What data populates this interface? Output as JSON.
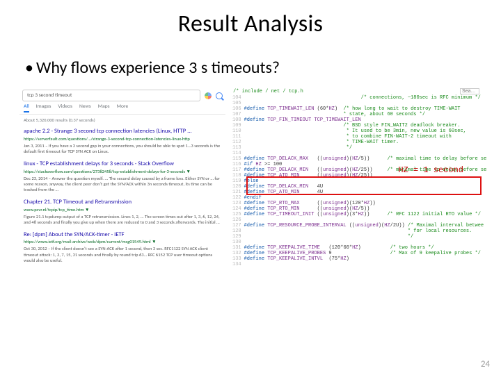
{
  "title": "Result Analysis",
  "bullet": "Why flows experience 3 s timeouts?",
  "page_number": "24",
  "hz_label": "HZ = 1 second",
  "google": {
    "query": "tcp 3 second timeout",
    "tabs": [
      "All",
      "Images",
      "Videos",
      "News",
      "Maps",
      "More"
    ],
    "stats": "About 5,320,000 results (0.37 seconds)",
    "mic_icon": "mic-icon",
    "search_icon": "search-icon",
    "results": [
      {
        "title": "apache 2.2 - Strange 3 second tcp connection latencies (Linux, HTTP ...",
        "url": "https://serverfault.com/questions/…/strange-3-second-tcp-connection-latencies-linux-http",
        "desc": "Jan 3, 2011 – If you have a 3 second gap in your connections, you should be able to spot 1…3 seconds is the default first timeout for TCP SYN ACK on Linux."
      },
      {
        "title": "linux - TCP establishment delays for 3 seconds - Stack Overflow",
        "url": "https://stackoverflow.com/questions/27382458/tcp-establishment-delays-for-3-seconds ▼",
        "desc": "Dec 23, 2014 – Answer the question myself. ... The second delay caused by a frame loss. Either SYN or … for some reason, anyway, the client peer don't get the SYN/ACK within 3n seconds timeout, its time can be tracked from the …"
      },
      {
        "title": "Chapter 21. TCP Timeout and Retransmission",
        "url": "www.pcvr.nl/tcpip/tcp_time.htm ▼",
        "desc": "Figure 21.1 tcpdump output of a TCP retransmission. Lines 1, 2, … The screen times out after 1, 3, 6, 12, 24, and 48 seconds and finally you give up when there are reduced to 0 and 3 seconds afterwards. The initial …"
      },
      {
        "title": "Re: [dpm] About the SYN/ACK-timer - IETF",
        "url": "https://www.ietf.org/mail-archive/web/dpm/current/msg01549.html ▼",
        "desc": "Oct 30, 2012 – If the client doesn't see a SYN-ACK after 1 second, then 3 sec. RFC1122 SYN ACK client timeout attack: 1, 3, 7, 15, 31 seconds and finally by round trip 63… RFC 6152 TCP user timeout options would also be useful."
      }
    ]
  },
  "code": {
    "file_hint": "/* include / net / tcp.h",
    "search_placeholder": "Sea…",
    "lines": [
      {
        "n": "104",
        "t": "                                        /* connections, ~180sec is RFC minimum */",
        "cls": "cm"
      },
      {
        "n": "105",
        "t": ""
      },
      {
        "n": "106",
        "t": "#define TCP_TIMEWAIT_LEN (60*HZ)  /* how long to wait to destroy TIME-WAIT"
      },
      {
        "n": "107",
        "t": "                                  * state, about 60 seconds */",
        "cls": "cm"
      },
      {
        "n": "108",
        "t": "#define TCP_FIN_TIMEOUT TCP_TIMEWAIT_LEN"
      },
      {
        "n": "109",
        "t": "                                  /* BSD style FIN_WAIT2 deadlock breaker.",
        "cls": "cm"
      },
      {
        "n": "110",
        "t": "                                   * It used to be 3min, new value is 60sec,",
        "cls": "cm"
      },
      {
        "n": "111",
        "t": "                                   * to combine FIN-WAIT-2 timeout with",
        "cls": "cm"
      },
      {
        "n": "112",
        "t": "                                   * TIME-WAIT timer.",
        "cls": "cm"
      },
      {
        "n": "113",
        "t": "                                   */",
        "cls": "cm"
      },
      {
        "n": "114",
        "t": ""
      },
      {
        "n": "115",
        "t": "#define TCP_DELACK_MAX   ((unsigned)(HZ/5))      /* maximal time to delay before se"
      },
      {
        "n": "116",
        "t": "#if HZ >= 100"
      },
      {
        "n": "117",
        "t": "#define TCP_DELACK_MIN   ((unsigned)(HZ/25))     /* minimal time to delay before se"
      },
      {
        "n": "118",
        "t": "#define TCP_ATO_MIN      ((unsigned)(HZ/25))"
      },
      {
        "n": "119",
        "t": "#else"
      },
      {
        "n": "120",
        "t": "#define TCP_DELACK_MIN   4U"
      },
      {
        "n": "121",
        "t": "#define TCP_ATO_MIN      4U"
      },
      {
        "n": "122",
        "t": "#endif"
      },
      {
        "n": "123",
        "t": "#define TCP_RTO_MAX      ((unsigned)(120*HZ))"
      },
      {
        "n": "124",
        "t": "#define TCP_RTO_MIN      ((unsigned)(HZ/5))"
      },
      {
        "n": "125",
        "t": "#define TCP_TIMEOUT_INIT ((unsigned)(3*HZ))      /* RFC 1122 initial RTO value */"
      },
      {
        "n": "126",
        "t": ""
      },
      {
        "n": "127",
        "t": "#define TCP_RESOURCE_PROBE_INTERVAL ((unsigned)(HZ/2U)) /* Maximal interval betwee"
      },
      {
        "n": "128",
        "t": "                                                        * for local resources.",
        "cls": "cm"
      },
      {
        "n": "129",
        "t": "                                                        */",
        "cls": "cm"
      },
      {
        "n": "130",
        "t": ""
      },
      {
        "n": "131",
        "t": "#define TCP_KEEPALIVE_TIME   (120*60*HZ)          /* two hours */"
      },
      {
        "n": "132",
        "t": "#define TCP_KEEPALIVE_PROBES 9                    /* Max of 9 keepalive probes */"
      },
      {
        "n": "133",
        "t": "#define TCP_KEEPALIVE_INTVL  (75*HZ)"
      },
      {
        "n": "134",
        "t": ""
      }
    ]
  }
}
